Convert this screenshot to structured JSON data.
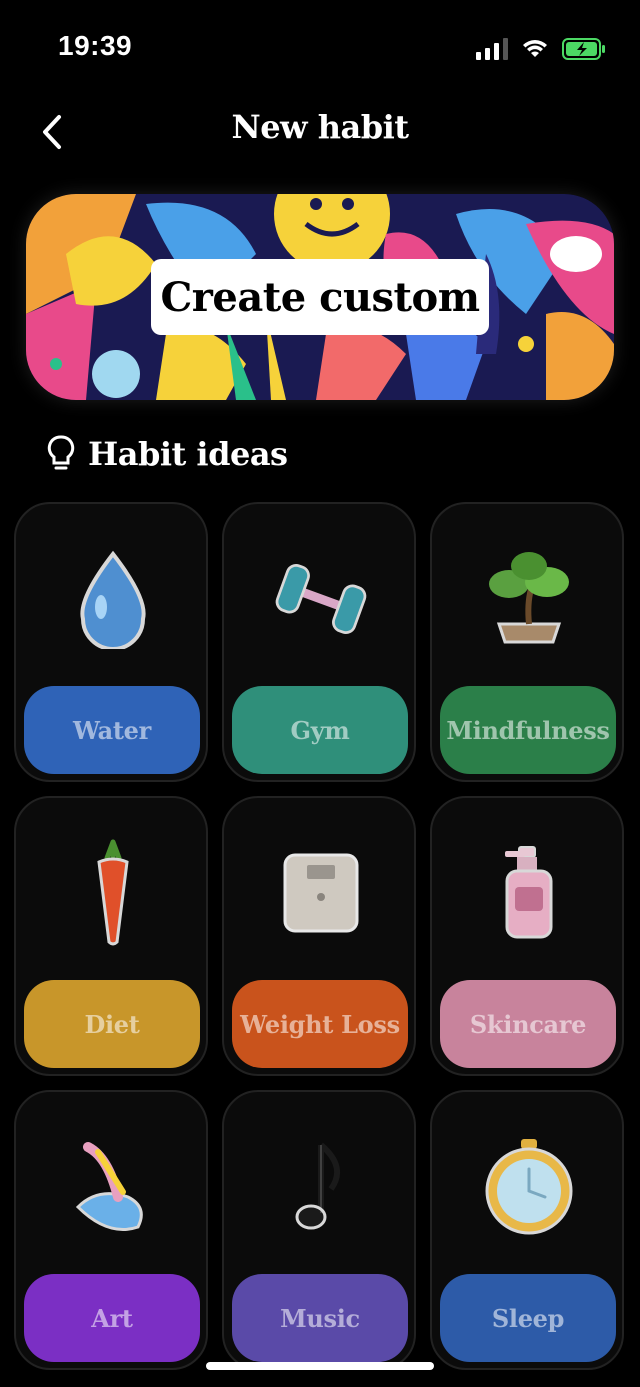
{
  "status": {
    "time": "19:39"
  },
  "nav": {
    "title": "New habit"
  },
  "banner": {
    "label": "Create custom"
  },
  "section": {
    "title": "Habit ideas"
  },
  "habits": [
    {
      "label": "Water",
      "icon": "water-drop-icon",
      "color": "#2f63b7"
    },
    {
      "label": "Gym",
      "icon": "dumbbell-icon",
      "color": "#2f8f7a"
    },
    {
      "label": "Mindfulness",
      "icon": "bonsai-icon",
      "color": "#2b7f49"
    },
    {
      "label": "Diet",
      "icon": "carrot-icon",
      "color": "#c8962a"
    },
    {
      "label": "Weight Loss",
      "icon": "scale-icon",
      "color": "#c9531c"
    },
    {
      "label": "Skincare",
      "icon": "lotion-bottle-icon",
      "color": "#c8839c"
    },
    {
      "label": "Art",
      "icon": "paintbrush-icon",
      "color": "#7b2fc4"
    },
    {
      "label": "Music",
      "icon": "music-note-icon",
      "color": "#5a4aa8"
    },
    {
      "label": "Sleep",
      "icon": "clock-icon",
      "color": "#2d5ba8"
    }
  ]
}
